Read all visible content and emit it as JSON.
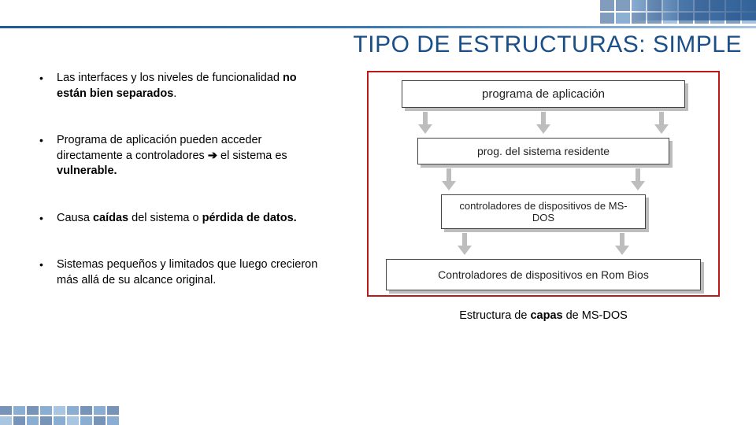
{
  "title": "TIPO DE ESTRUCTURAS: SIMPLE",
  "bullets": [
    {
      "pre": "Las interfaces y los niveles de funcionalidad ",
      "bold": "no están bien separados",
      "post": "."
    },
    {
      "pre": "Programa de aplicación pueden acceder directamente a controladores    ",
      "arrow": "➔",
      "mid": "   el sistema es ",
      "bold": "vulnerable.",
      "post": ""
    },
    {
      "pre": "Causa ",
      "bold": "caídas",
      "mid2": " del sistema o ",
      "bold2": "pérdida de datos.",
      "post": ""
    },
    {
      "pre": "Sistemas pequeños y limitados que luego crecieron más allá de su alcance original.",
      "bold": "",
      "post": ""
    }
  ],
  "diagram": {
    "layers": [
      "programa de aplicación",
      "prog. del sistema residente",
      "controladores de dispositivos de MS-DOS",
      "Controladores de dispositivos en Rom Bios"
    ]
  },
  "caption_pre": "Estructura de ",
  "caption_bold": "capas",
  "caption_post": " de MS-DOS"
}
